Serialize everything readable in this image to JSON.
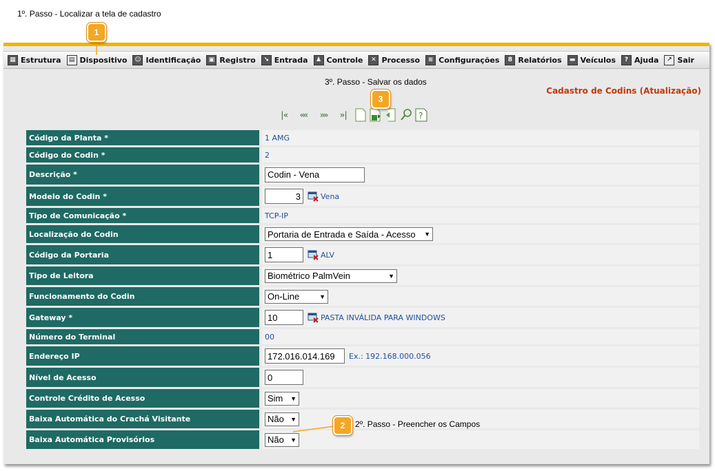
{
  "annotations": {
    "step1": "1º. Passo - Localizar a tela de cadastro",
    "step2": "2º. Passo - Preencher os Campos",
    "step3": "3º. Passo - Salvar os dados",
    "badge1": "1",
    "badge2": "2",
    "badge3": "3"
  },
  "menu": [
    {
      "label": "Estrutura",
      "icon": "grid-icon"
    },
    {
      "label": "Dispositivo",
      "icon": "device-icon"
    },
    {
      "label": "Identificação",
      "icon": "people-icon"
    },
    {
      "label": "Registro",
      "icon": "register-icon"
    },
    {
      "label": "Entrada",
      "icon": "entry-icon"
    },
    {
      "label": "Controle",
      "icon": "control-icon"
    },
    {
      "label": "Processo",
      "icon": "tools-icon"
    },
    {
      "label": "Configurações",
      "icon": "config-icon"
    },
    {
      "label": "Relatórios",
      "icon": "report-icon"
    },
    {
      "label": "Veículos",
      "icon": "vehicle-icon"
    },
    {
      "label": "Ajuda",
      "icon": "help-icon"
    },
    {
      "label": "Sair",
      "icon": "exit-icon"
    }
  ],
  "page_title": "Cadastro de Codins (Atualização)",
  "form": {
    "codigo_planta": {
      "label": "Código da Planta *",
      "value": "1 AMG"
    },
    "codigo_codin": {
      "label": "Código do Codin *",
      "value": "2"
    },
    "descricao": {
      "label": "Descrição *",
      "value": "Codin - Vena"
    },
    "modelo": {
      "label": "Modelo do Codin *",
      "value": "3",
      "lookup": "Vena"
    },
    "tipo_comunicacao": {
      "label": "Tipo de Comunicação *",
      "value": "TCP-IP"
    },
    "localizacao": {
      "label": "Localização do Codin",
      "value": "Portaria de Entrada e Saída - Acesso"
    },
    "codigo_portaria": {
      "label": "Código da Portaria",
      "value": "1",
      "lookup": "ALV"
    },
    "tipo_leitora": {
      "label": "Tipo de Leitora",
      "value": "Biométrico PalmVein"
    },
    "funcionamento": {
      "label": "Funcionamento do Codin",
      "value": "On-Line"
    },
    "gateway": {
      "label": "Gateway *",
      "value": "10",
      "lookup": "PASTA INVÁLIDA PARA WINDOWS"
    },
    "numero_terminal": {
      "label": "Número do Terminal",
      "value": "00"
    },
    "endereco_ip": {
      "label": "Endereço IP",
      "value": "172.016.014.169",
      "hint": "Ex.: 192.168.000.056"
    },
    "nivel_acesso": {
      "label": "Nível de Acesso",
      "value": "0"
    },
    "controle_credito": {
      "label": "Controle Crédito de Acesso",
      "value": "Sim"
    },
    "baixa_cracha": {
      "label": "Baixa Automática do Crachá Visitante",
      "value": "Não"
    },
    "baixa_provisorios": {
      "label": "Baixa Automática Provisórios",
      "value": "Não"
    }
  },
  "colors": {
    "label_bg": "#1f6a64",
    "accent": "#f0b400",
    "title": "#c0390b",
    "link": "#1f4fa0"
  }
}
